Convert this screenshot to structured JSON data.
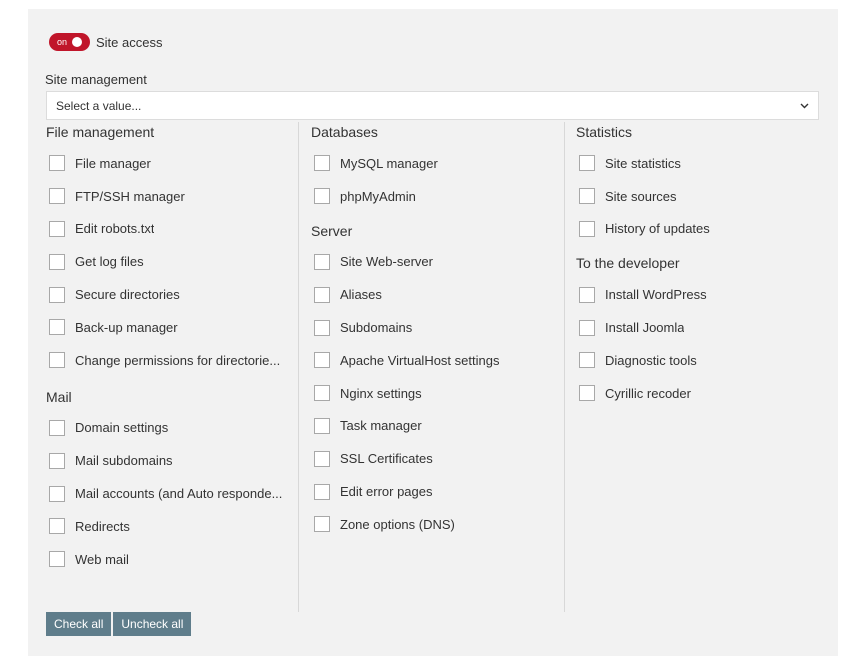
{
  "site_access": {
    "toggle_state": "on",
    "label": "Site access"
  },
  "site_management": {
    "label": "Site management",
    "select_value": "Select a value..."
  },
  "groups": {
    "file_management": {
      "title": "File management",
      "items": [
        "File manager",
        "FTP/SSH manager",
        "Edit robots.txt",
        "Get log files",
        "Secure directories",
        "Back-up manager",
        "Change permissions for directorie..."
      ]
    },
    "mail": {
      "title": "Mail",
      "items": [
        "Domain settings",
        "Mail subdomains",
        "Mail accounts (and Auto responde...",
        "Redirects",
        "Web mail"
      ]
    },
    "databases": {
      "title": "Databases",
      "items": [
        "MySQL manager",
        "phpMyAdmin"
      ]
    },
    "server": {
      "title": "Server",
      "items": [
        "Site Web-server",
        "Aliases",
        "Subdomains",
        "Apache VirtualHost settings",
        "Nginx settings",
        "Task manager",
        "SSL Certificates",
        "Edit error pages",
        "Zone options (DNS)"
      ]
    },
    "statistics": {
      "title": "Statistics",
      "items": [
        "Site statistics",
        "Site sources",
        "History of updates"
      ]
    },
    "developer": {
      "title": "To the developer",
      "items": [
        "Install WordPress",
        "Install Joomla",
        "Diagnostic tools",
        "Cyrillic recoder"
      ]
    }
  },
  "buttons": {
    "check_all": "Check all",
    "uncheck_all": "Uncheck all"
  },
  "colors": {
    "toggle_on": "#c0152a",
    "button_bg": "#5f7d8b",
    "panel_bg": "#f2f2f2"
  }
}
